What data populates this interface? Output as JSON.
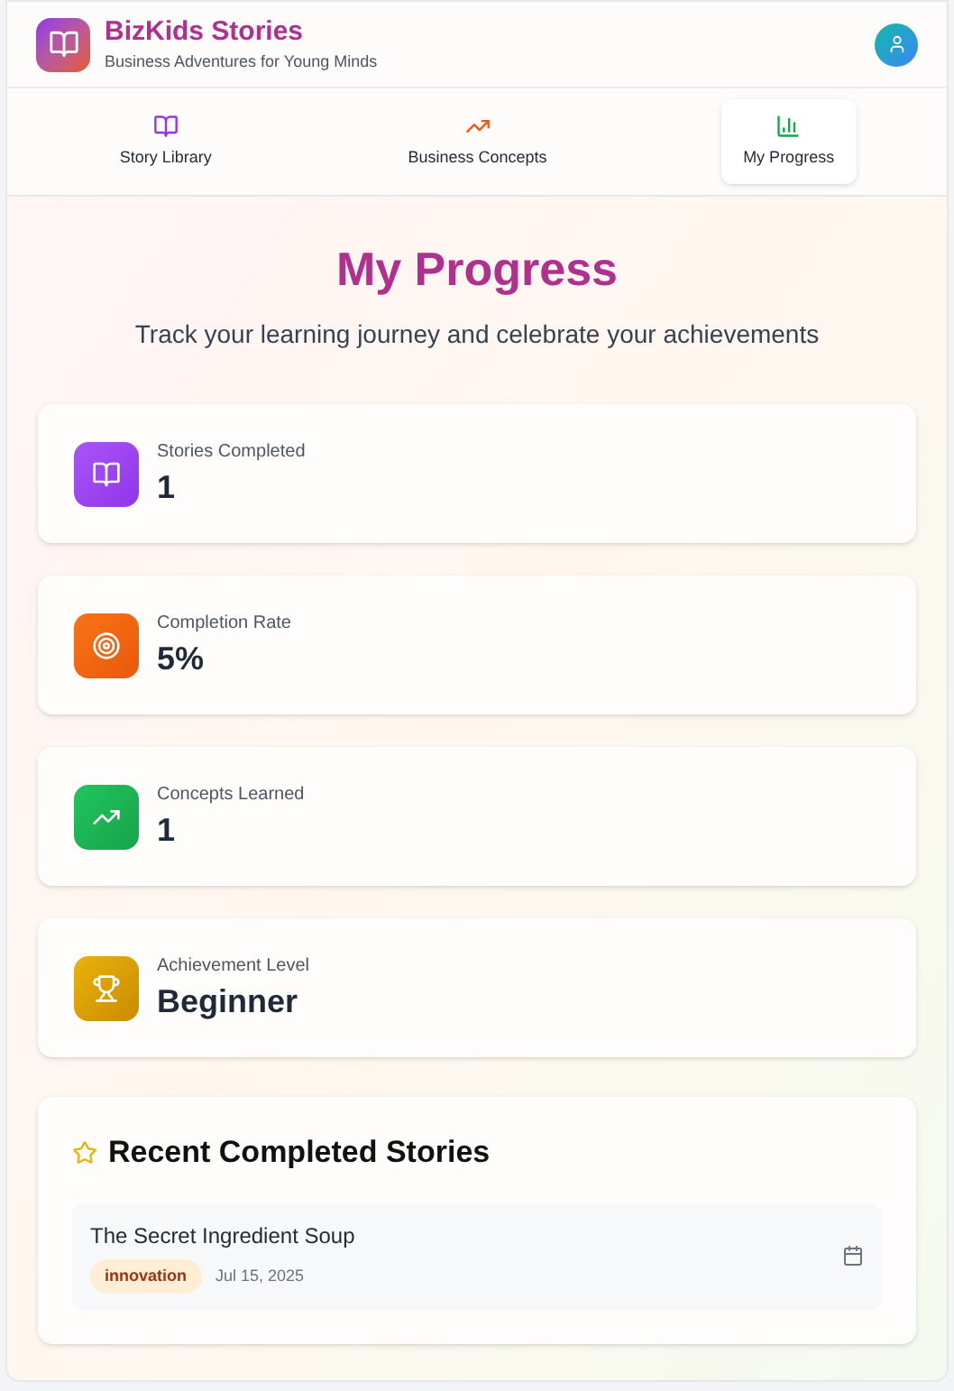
{
  "header": {
    "title": "BizKids Stories",
    "subtitle": "Business Adventures for Young Minds"
  },
  "tabs": [
    {
      "label": "Story Library",
      "kind": "book",
      "selected": false
    },
    {
      "label": "Business Concepts",
      "kind": "trend",
      "selected": false
    },
    {
      "label": "My Progress",
      "kind": "chart",
      "selected": true
    }
  ],
  "page": {
    "title": "My Progress",
    "subtitle": "Track your learning journey and celebrate your achievements"
  },
  "stats": [
    {
      "label": "Stories Completed",
      "value": "1",
      "kind": "book"
    },
    {
      "label": "Completion Rate",
      "value": "5%",
      "kind": "target"
    },
    {
      "label": "Concepts Learned",
      "value": "1",
      "kind": "trend"
    },
    {
      "label": "Achievement Level",
      "value": "Beginner",
      "kind": "trophy"
    }
  ],
  "recent": {
    "title": "Recent Completed Stories",
    "items": [
      {
        "title": "The Secret Ingredient Soup",
        "tag": "innovation",
        "date": "Jul 15, 2025"
      }
    ]
  }
}
